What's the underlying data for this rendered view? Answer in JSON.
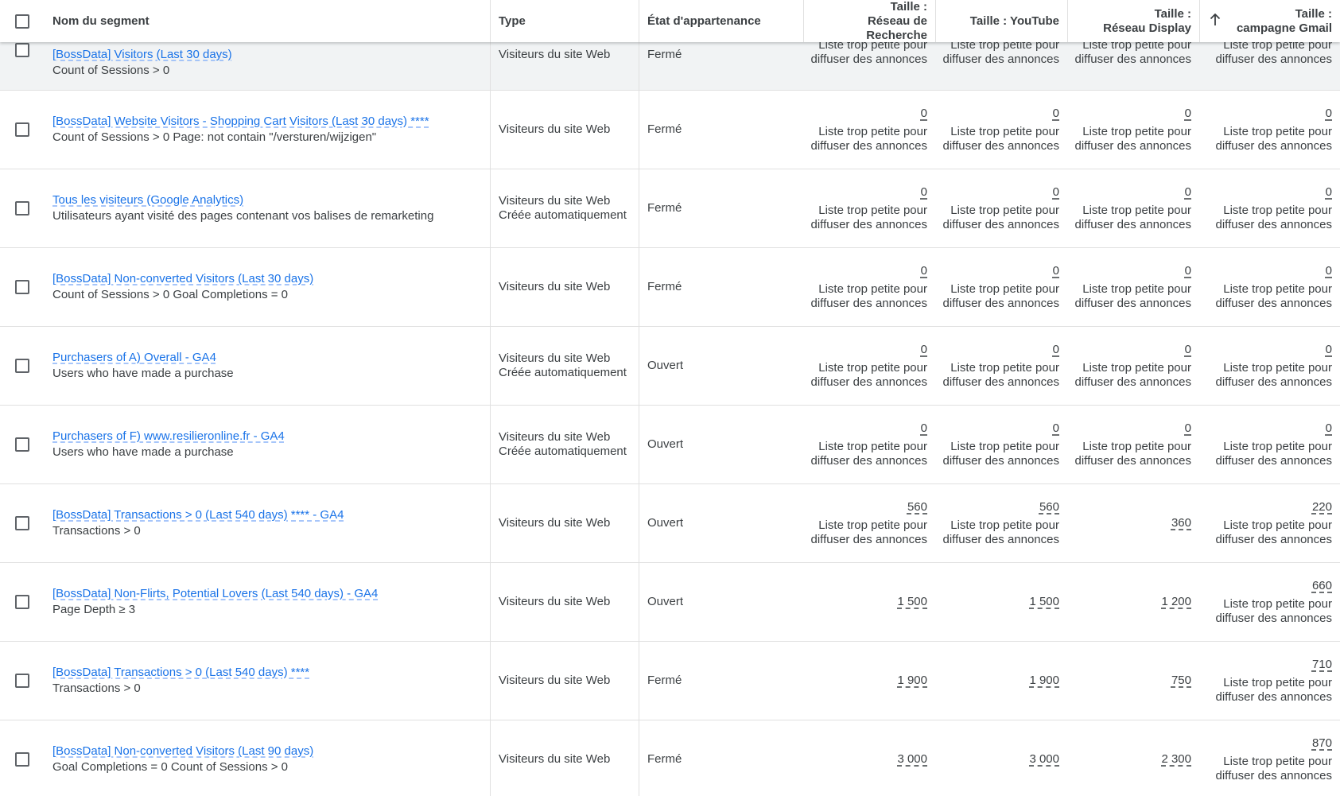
{
  "header": {
    "name": "Nom du segment",
    "type": "Type",
    "state": "État d'appartenance",
    "search_l1": "Taille :",
    "search_l2": "Réseau de Recherche",
    "youtube": "Taille : YouTube",
    "display_l1": "Taille :",
    "display_l2": "Réseau Display",
    "gmail_l1": "Taille :",
    "gmail_l2": "campagne Gmail",
    "sort_icon": "arrow-up-icon"
  },
  "note": "Liste trop petite pour diffuser des annonces",
  "rows": [
    {
      "name": "[BossData] Visitors (Last 30 days)",
      "desc": "Count of Sessions > 0",
      "type": "Visiteurs du site Web",
      "type2": "",
      "state": "Fermé",
      "search": {
        "num": "",
        "note": "Liste trop petite pour diffuser des annonces"
      },
      "youtube": {
        "num": "",
        "note": "Liste trop petite pour diffuser des annonces"
      },
      "display": {
        "num": "",
        "note": "Liste trop petite pour diffuser des annonces"
      },
      "gmail": {
        "num": "",
        "note": "Liste trop petite pour diffuser des annonces"
      }
    },
    {
      "name": "[BossData] Website Visitors - Shopping Cart Visitors (Last 30 days) ****",
      "desc": "Count of Sessions > 0 Page: not contain \"/versturen/wijzigen\"",
      "type": "Visiteurs du site Web",
      "type2": "",
      "state": "Fermé",
      "search": {
        "num": "0",
        "note": "Liste trop petite pour diffuser des annonces"
      },
      "youtube": {
        "num": "0",
        "note": "Liste trop petite pour diffuser des annonces"
      },
      "display": {
        "num": "0",
        "note": "Liste trop petite pour diffuser des annonces"
      },
      "gmail": {
        "num": "0",
        "note": "Liste trop petite pour diffuser des annonces"
      }
    },
    {
      "name": "Tous les visiteurs (Google Analytics)",
      "desc": "Utilisateurs ayant visité des pages contenant vos balises de remarketing",
      "type": "Visiteurs du site Web",
      "type2": "Créée automatiquement",
      "state": "Fermé",
      "search": {
        "num": "0",
        "note": "Liste trop petite pour diffuser des annonces"
      },
      "youtube": {
        "num": "0",
        "note": "Liste trop petite pour diffuser des annonces"
      },
      "display": {
        "num": "0",
        "note": "Liste trop petite pour diffuser des annonces"
      },
      "gmail": {
        "num": "0",
        "note": "Liste trop petite pour diffuser des annonces"
      }
    },
    {
      "name": "[BossData] Non-converted Visitors (Last 30 days)",
      "desc": "Count of Sessions > 0 Goal Completions = 0",
      "type": "Visiteurs du site Web",
      "type2": "",
      "state": "Fermé",
      "search": {
        "num": "0",
        "note": "Liste trop petite pour diffuser des annonces"
      },
      "youtube": {
        "num": "0",
        "note": "Liste trop petite pour diffuser des annonces"
      },
      "display": {
        "num": "0",
        "note": "Liste trop petite pour diffuser des annonces"
      },
      "gmail": {
        "num": "0",
        "note": "Liste trop petite pour diffuser des annonces"
      }
    },
    {
      "name": "Purchasers of A) Overall - GA4",
      "desc": "Users who have made a purchase",
      "type": "Visiteurs du site Web",
      "type2": "Créée automatiquement",
      "state": "Ouvert",
      "search": {
        "num": "0",
        "note": "Liste trop petite pour diffuser des annonces"
      },
      "youtube": {
        "num": "0",
        "note": "Liste trop petite pour diffuser des annonces"
      },
      "display": {
        "num": "0",
        "note": "Liste trop petite pour diffuser des annonces"
      },
      "gmail": {
        "num": "0",
        "note": "Liste trop petite pour diffuser des annonces"
      }
    },
    {
      "name": "Purchasers of F) www.resilieronline.fr - GA4",
      "desc": "Users who have made a purchase",
      "type": "Visiteurs du site Web",
      "type2": "Créée automatiquement",
      "state": "Ouvert",
      "search": {
        "num": "0",
        "note": "Liste trop petite pour diffuser des annonces"
      },
      "youtube": {
        "num": "0",
        "note": "Liste trop petite pour diffuser des annonces"
      },
      "display": {
        "num": "0",
        "note": "Liste trop petite pour diffuser des annonces"
      },
      "gmail": {
        "num": "0",
        "note": "Liste trop petite pour diffuser des annonces"
      }
    },
    {
      "name": "[BossData] Transactions > 0 (Last 540 days) **** - GA4",
      "desc": "Transactions > 0",
      "type": "Visiteurs du site Web",
      "type2": "",
      "state": "Ouvert",
      "search": {
        "num": "560",
        "note": "Liste trop petite pour diffuser des annonces"
      },
      "youtube": {
        "num": "560",
        "note": "Liste trop petite pour diffuser des annonces"
      },
      "display": {
        "num": "360",
        "note": ""
      },
      "gmail": {
        "num": "220",
        "note": "Liste trop petite pour diffuser des annonces"
      }
    },
    {
      "name": "[BossData] Non-Flirts, Potential Lovers (Last 540 days) - GA4",
      "desc": "Page Depth ≥ 3",
      "type": "Visiteurs du site Web",
      "type2": "",
      "state": "Ouvert",
      "search": {
        "num": "1 500",
        "note": ""
      },
      "youtube": {
        "num": "1 500",
        "note": ""
      },
      "display": {
        "num": "1 200",
        "note": ""
      },
      "gmail": {
        "num": "660",
        "note": "Liste trop petite pour diffuser des annonces"
      }
    },
    {
      "name": "[BossData] Transactions > 0 (Last 540 days) ****",
      "desc": "Transactions > 0",
      "type": "Visiteurs du site Web",
      "type2": "",
      "state": "Fermé",
      "search": {
        "num": "1 900",
        "note": ""
      },
      "youtube": {
        "num": "1 900",
        "note": ""
      },
      "display": {
        "num": "750",
        "note": ""
      },
      "gmail": {
        "num": "710",
        "note": "Liste trop petite pour diffuser des annonces"
      }
    },
    {
      "name": "[BossData] Non-converted Visitors (Last 90 days)",
      "desc": "Goal Completions = 0 Count of Sessions > 0",
      "type": "Visiteurs du site Web",
      "type2": "",
      "state": "Fermé",
      "search": {
        "num": "3 000",
        "note": ""
      },
      "youtube": {
        "num": "3 000",
        "note": ""
      },
      "display": {
        "num": "2 300",
        "note": ""
      },
      "gmail": {
        "num": "870",
        "note": "Liste trop petite pour diffuser des annonces"
      }
    }
  ]
}
